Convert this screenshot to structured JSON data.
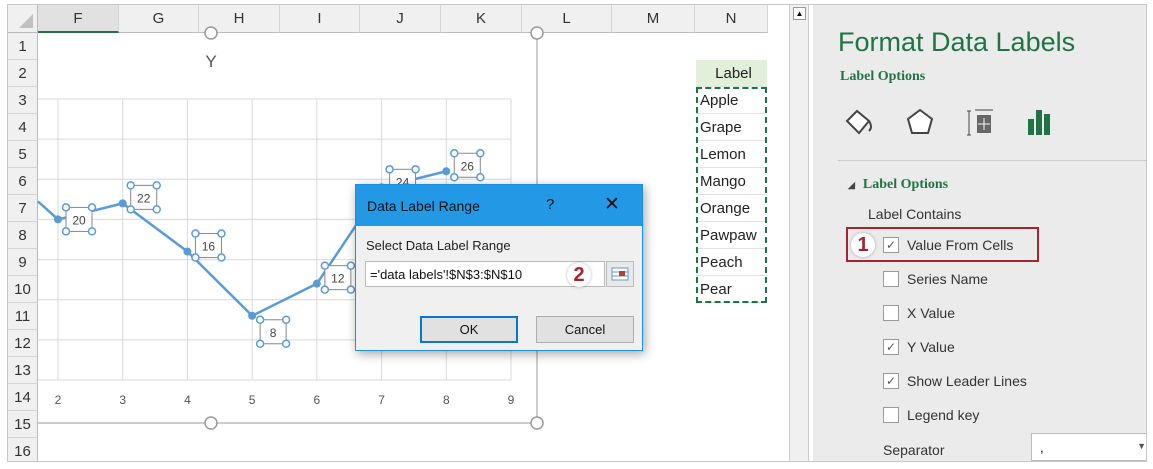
{
  "sheet": {
    "columns": [
      "F",
      "G",
      "H",
      "I",
      "J",
      "K",
      "L",
      "M",
      "N"
    ],
    "rows": [
      "1",
      "2",
      "3",
      "4",
      "5",
      "6",
      "7",
      "8",
      "9",
      "10",
      "11",
      "12",
      "13",
      "14",
      "15",
      "16"
    ],
    "label_header": "Label",
    "labels": [
      "Apple",
      "Grape",
      "Lemon",
      "Mango",
      "Orange",
      "Pawpaw",
      "Peach",
      "Pear"
    ]
  },
  "chart_data": {
    "type": "scatter",
    "title": "Y",
    "x": [
      2,
      3,
      4,
      5,
      6,
      7,
      8
    ],
    "y": [
      20,
      22,
      16,
      8,
      12,
      24,
      26
    ],
    "data_labels": [
      "20",
      "22",
      "16",
      "8",
      "12",
      "24",
      "26"
    ],
    "xlim": [
      2,
      9
    ],
    "ylim": [
      0,
      35
    ],
    "xticks": [
      "2",
      "3",
      "4",
      "5",
      "6",
      "7",
      "8",
      "9"
    ],
    "grid": true,
    "series_color": "#5b9bd5"
  },
  "dialog": {
    "title": "Data Label Range",
    "help": "?",
    "close": "✕",
    "prompt": "Select Data Label Range",
    "range_value": "='data labels'!$N$3:$N$10",
    "ok": "OK",
    "cancel": "Cancel",
    "step_badge": "2"
  },
  "panel": {
    "title": "Format Data Labels",
    "subtitle": "Label Options",
    "section": "Label Options",
    "label_contains": "Label Contains",
    "step_badge": "1",
    "options": [
      {
        "label": "Value From Cells",
        "checked": true
      },
      {
        "label": "Series Name",
        "checked": false
      },
      {
        "label": "X Value",
        "checked": false
      },
      {
        "label": "Y Value",
        "checked": true
      },
      {
        "label": "Show Leader Lines",
        "checked": true
      },
      {
        "label": "Legend key",
        "checked": false
      }
    ],
    "separator_label": "Separator",
    "separator_value": ",",
    "accent": "#217346"
  }
}
